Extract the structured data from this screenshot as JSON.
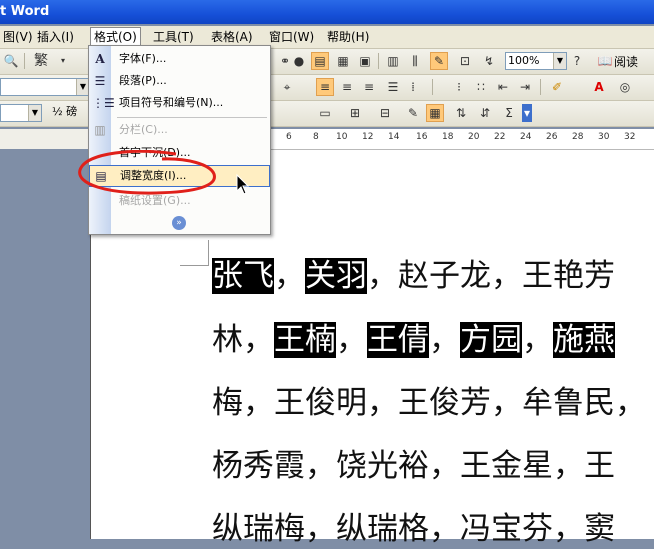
{
  "window": {
    "title": "t Word"
  },
  "menubar": {
    "items": [
      {
        "label": "图(V)"
      },
      {
        "label": "插入(I)"
      },
      {
        "label": "格式(O)"
      },
      {
        "label": "工具(T)"
      },
      {
        "label": "表格(A)"
      },
      {
        "label": "窗口(W)"
      },
      {
        "label": "帮助(H)"
      }
    ]
  },
  "toolbar1": {
    "trad_label": "繁",
    "zoom_value": "100%",
    "read_label": "阅读"
  },
  "toolbar3": {
    "size_value": "½ 磅"
  },
  "ruler": {
    "ticks": [
      "6",
      "8",
      "10",
      "12",
      "14",
      "16",
      "18",
      "20",
      "22",
      "24",
      "26",
      "28",
      "30",
      "32"
    ]
  },
  "format_menu": {
    "items": [
      {
        "label": "字体(F)...",
        "icon": "font-a-icon"
      },
      {
        "label": "段落(P)...",
        "icon": "paragraph-icon"
      },
      {
        "label": "项目符号和编号(N)...",
        "icon": "list-icon"
      },
      {
        "label": "分栏(C)...",
        "icon": "columns-icon"
      },
      {
        "label": "首字下沉(D)...",
        "icon": ""
      },
      {
        "label": "调整宽度(I)...",
        "icon": "fit-width-icon"
      },
      {
        "label": "稿纸设置(G)...",
        "icon": ""
      }
    ]
  },
  "document": {
    "lines": [
      [
        {
          "t": "张飞",
          "hl": true
        },
        {
          "t": "，",
          "hl": false
        },
        {
          "t": "关羽",
          "hl": true
        },
        {
          "t": "，赵子龙，王艳芳",
          "hl": false
        }
      ],
      [
        {
          "t": "林，",
          "hl": false
        },
        {
          "t": "王楠",
          "hl": true
        },
        {
          "t": "，",
          "hl": false
        },
        {
          "t": "王倩",
          "hl": true
        },
        {
          "t": "，",
          "hl": false
        },
        {
          "t": "方园",
          "hl": true
        },
        {
          "t": "，",
          "hl": false
        },
        {
          "t": "施燕",
          "hl": true
        }
      ],
      [
        {
          "t": "梅，王俊明，王俊芳，牟鲁民，",
          "hl": false
        }
      ],
      [
        {
          "t": "杨秀霞，饶光裕，王金星，王",
          "hl": false
        }
      ],
      [
        {
          "t": "纵瑞梅，纵瑞格，冯宝芬，窦",
          "hl": false
        }
      ]
    ]
  },
  "colors": {
    "highlight_bg": "#000000",
    "annotation_red": "#e0201a",
    "hover_bg": "#ffeec2"
  }
}
